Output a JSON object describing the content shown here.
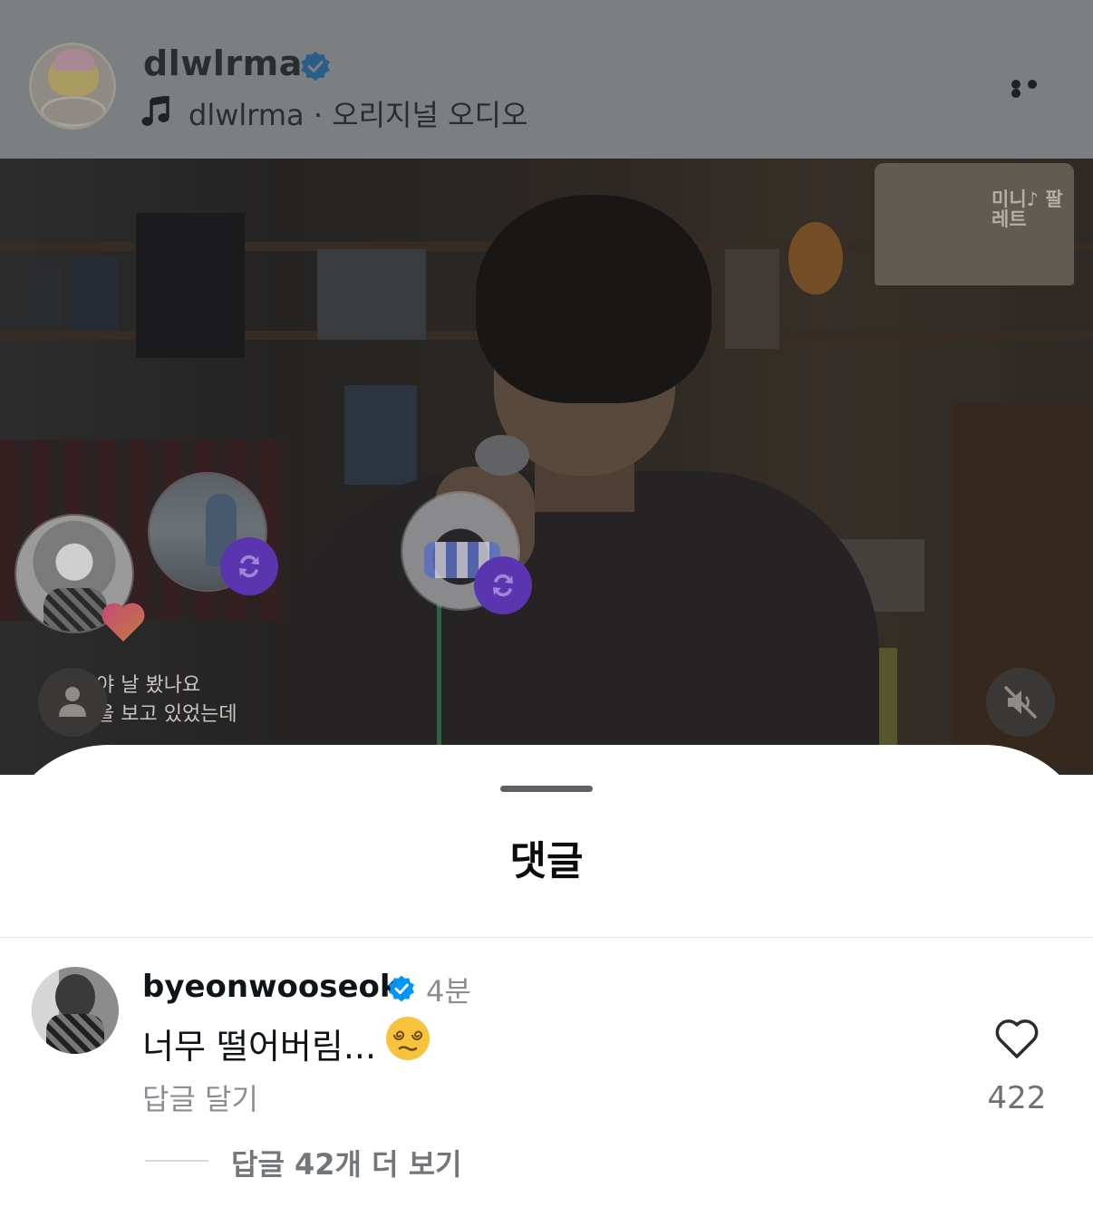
{
  "post": {
    "username": "dlwlrma",
    "verified": true,
    "audio_label": "dlwlrma · 오리지널 오디오",
    "icons": {
      "music": "music-note-icon",
      "more": "more-horizontal-icon",
      "verified": "verified-badge-icon"
    }
  },
  "video": {
    "watermark": "미니♪ 팔레트",
    "lyrics_line1": "야 날 봤나요",
    "lyrics_line2": "을 보고 있었는데",
    "icons": {
      "user_tag": "person-icon",
      "mute": "speaker-muted-icon",
      "repost": "repost-icon",
      "heart": "heart-icon"
    }
  },
  "comments_sheet": {
    "title": "댓글",
    "comment": {
      "username": "byeonwooseok",
      "verified": true,
      "time": "4분",
      "text": "너무 떨어버림...",
      "emoji": "dizzy-face-emoji",
      "reply_label": "답글 달기",
      "like_count": "422",
      "more_replies_label": "답글 42개 더 보기"
    }
  },
  "colors": {
    "verified_blue": "#0095f6",
    "repost_purple": "#5b34b0",
    "text_primary": "#0f1419",
    "text_secondary": "#8a8d91"
  }
}
